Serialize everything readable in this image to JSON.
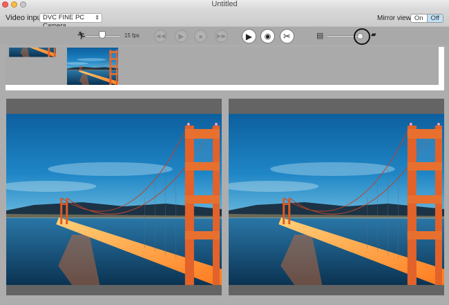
{
  "window": {
    "title": "Untitled"
  },
  "video_input": {
    "label": "Video input:",
    "selected": "DVC FINE PC Camera"
  },
  "mirror_view": {
    "label": "Mirror view:",
    "options": [
      "On",
      "Off"
    ],
    "selected": "Off"
  },
  "toolbar": {
    "frame_rate": "15 fps",
    "frame_rate_slider_value": 0.5,
    "zoom_slider_value": 0.75
  },
  "thumbnails": [
    "sunset",
    "bridge-wide",
    "bridge-tower"
  ],
  "colors": {
    "accent": "#bfe0f5",
    "toolbar": "#a9a9a9",
    "panel": "#646464"
  }
}
